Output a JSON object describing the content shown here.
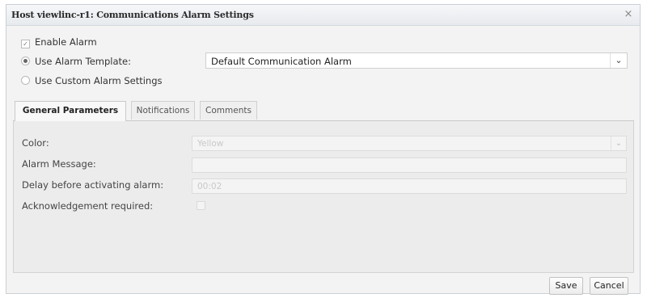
{
  "dialog": {
    "title": "Host viewlinc-r1: Communications Alarm Settings",
    "close_glyph": "×"
  },
  "options": {
    "enable_alarm": {
      "label": "Enable Alarm",
      "checked": true
    },
    "use_template": {
      "label": "Use Alarm Template:",
      "selected": true
    },
    "use_custom": {
      "label": "Use Custom Alarm Settings",
      "selected": false
    }
  },
  "template_select": {
    "value": "Default Communication Alarm"
  },
  "tabs": [
    {
      "label": "General Parameters",
      "active": true
    },
    {
      "label": "Notifications",
      "active": false
    },
    {
      "label": "Comments",
      "active": false
    }
  ],
  "general": {
    "color_label": "Color:",
    "color_value": "Yellow",
    "message_label": "Alarm Message:",
    "message_value": "",
    "delay_label": "Delay before activating alarm:",
    "delay_value": "00:02",
    "ack_label": "Acknowledgement required:",
    "ack_checked": false
  },
  "buttons": {
    "save": "Save",
    "cancel": "Cancel"
  },
  "icons": {
    "checkbox": "check-icon",
    "dropdown": "chevron-down-icon",
    "close": "close-icon"
  }
}
